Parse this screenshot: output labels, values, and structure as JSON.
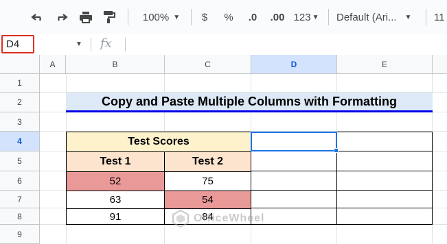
{
  "toolbar": {
    "zoom": "100%",
    "currency_symbol": "$",
    "percent_symbol": "%",
    "decrease_decimal": ".0",
    "increase_decimal": ".00",
    "more_formats": "123",
    "font_family": "Default (Ari...",
    "font_size": "11"
  },
  "formula_bar": {
    "cell_ref": "D4",
    "fx_label": "fx",
    "content": ""
  },
  "columns": [
    "A",
    "B",
    "C",
    "D",
    "E"
  ],
  "rows": [
    "1",
    "2",
    "3",
    "4",
    "5",
    "6",
    "7",
    "8",
    "9"
  ],
  "sheet": {
    "title": "Copy and Paste Multiple Columns with Formatting",
    "table_header": "Test Scores",
    "col1_header": "Test 1",
    "col2_header": "Test 2",
    "rows": [
      [
        "52",
        "75"
      ],
      [
        "63",
        "54"
      ],
      [
        "91",
        "84"
      ]
    ]
  },
  "watermark": "OfficeWheel",
  "colors": {
    "title_fill": "#dde9f6",
    "title_underline": "#0000e6",
    "header_fill": "#fdf2cc",
    "subheader_fill": "#fce4cf",
    "highlight_fill": "#ea9999",
    "selection": "#1a73e8",
    "namebox_highlight": "#d93025"
  }
}
